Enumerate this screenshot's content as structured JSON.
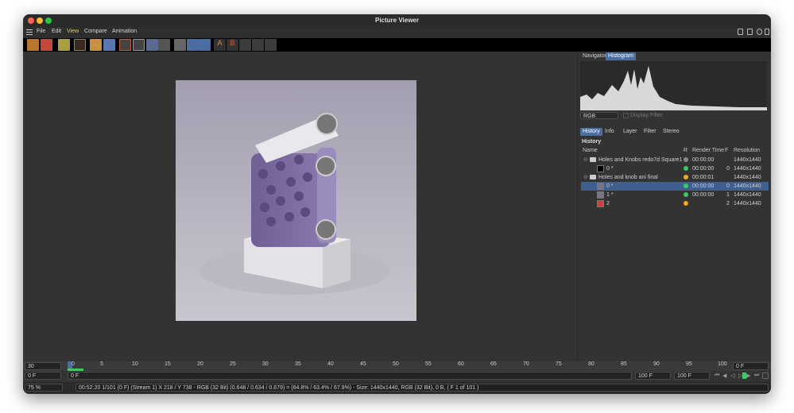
{
  "window": {
    "title": "Picture Viewer"
  },
  "menu": [
    "File",
    "Edit",
    "View",
    "Compare",
    "Animation"
  ],
  "panel": {
    "top_tabs": [
      "Navigator",
      "Histogram"
    ],
    "channel": "RGB",
    "display_filter": "Display Filter",
    "bottom_tabs": [
      "History",
      "Info",
      "Layer",
      "Filter",
      "Stereo"
    ],
    "section_title": "History",
    "columns": {
      "name": "Name",
      "r": "R",
      "render_time": "Render Time",
      "f": "F",
      "resolution": "Resolution"
    },
    "rows": [
      {
        "name": "Holes and Knobs redo7d Square1",
        "type": "folder",
        "status": "#8a8a8a",
        "time": "00:00:00",
        "f": "",
        "res": "1440x1440"
      },
      {
        "name": "0 *",
        "type": "image",
        "status": "#33cc66",
        "time": "00:00:00",
        "f": "0",
        "res": "1440x1440"
      },
      {
        "name": "Holes and knob ani final",
        "type": "folder",
        "status": "#f5a623",
        "time": "00:00:01",
        "f": "",
        "res": "1440x1440"
      },
      {
        "name": "0 *",
        "type": "image",
        "status": "#33cc66",
        "time": "00:00:00",
        "f": "0",
        "res": "1440x1440",
        "selected": true
      },
      {
        "name": "1 *",
        "type": "image",
        "status": "#33cc66",
        "time": "00:00:00",
        "f": "1",
        "res": "1440x1440"
      },
      {
        "name": "2",
        "type": "render",
        "status": "#f5a623",
        "time": "",
        "f": "2",
        "res": "1440x1440"
      }
    ]
  },
  "timeline": {
    "fps": "30",
    "ticks": [
      "0",
      "5",
      "10",
      "15",
      "20",
      "25",
      "30",
      "35",
      "40",
      "45",
      "50",
      "55",
      "60",
      "65",
      "70",
      "75",
      "80",
      "85",
      "90",
      "95",
      "100"
    ],
    "end_field": "0 F",
    "current": "0 F",
    "current2": "0 F",
    "start": "100 F",
    "end": "100 F"
  },
  "status": {
    "zoom": "75 %",
    "text": "00:52:20 1/101 (0 F) (Stream 1)    X 218 / Y 738 - RGB (32 Bit) (0.648 / 0.634 / 0.679) = (64.8% / 63.4% / 67.9%) - Size: 1440x1440, RGB (32 Bit), 0 B,  ( F 1 of 101 )"
  },
  "colors": {
    "accent": "#4a6ea0",
    "bg": "#333333",
    "toolbar": "#000000"
  }
}
